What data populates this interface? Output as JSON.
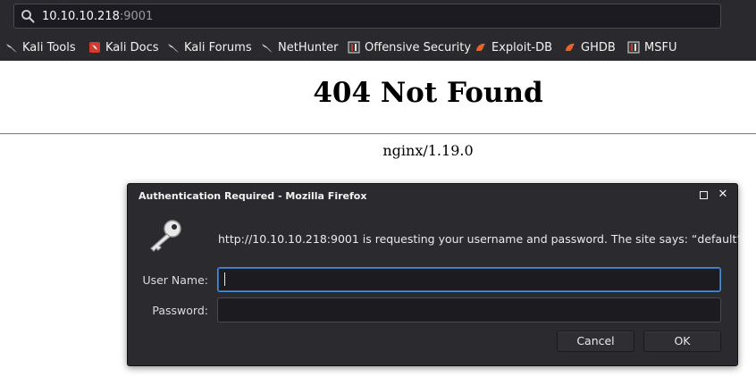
{
  "browser": {
    "url_host": "10.10.10.218",
    "url_port": ":9001",
    "bookmarks": [
      {
        "label": "Kali Tools",
        "icon": "kali-dragon-icon"
      },
      {
        "label": "Kali Docs",
        "icon": "kali-docs-icon"
      },
      {
        "label": "Kali Forums",
        "icon": "kali-dragon-icon"
      },
      {
        "label": "NetHunter",
        "icon": "kali-dragon-icon"
      },
      {
        "label": "Offensive Security",
        "icon": "offsec-icon"
      },
      {
        "label": "Exploit-DB",
        "icon": "exploit-db-icon"
      },
      {
        "label": "GHDB",
        "icon": "exploit-db-icon"
      },
      {
        "label": "MSFU",
        "icon": "offsec-icon"
      }
    ]
  },
  "page": {
    "title": "404 Not Found",
    "server": "nginx/1.19.0"
  },
  "dialog": {
    "title": "Authentication Required - Mozilla Firefox",
    "message": "http://10.10.10.218:9001 is requesting your username and password. The site says: “default”",
    "username_label": "User Name:",
    "username_value": "",
    "password_label": "Password:",
    "password_value": "",
    "cancel_label": "Cancel",
    "ok_label": "OK"
  },
  "colors": {
    "chrome_bg": "#2a2a2e",
    "dialog_bg": "#2b2b2f",
    "focus_accent": "#4a90d9"
  }
}
